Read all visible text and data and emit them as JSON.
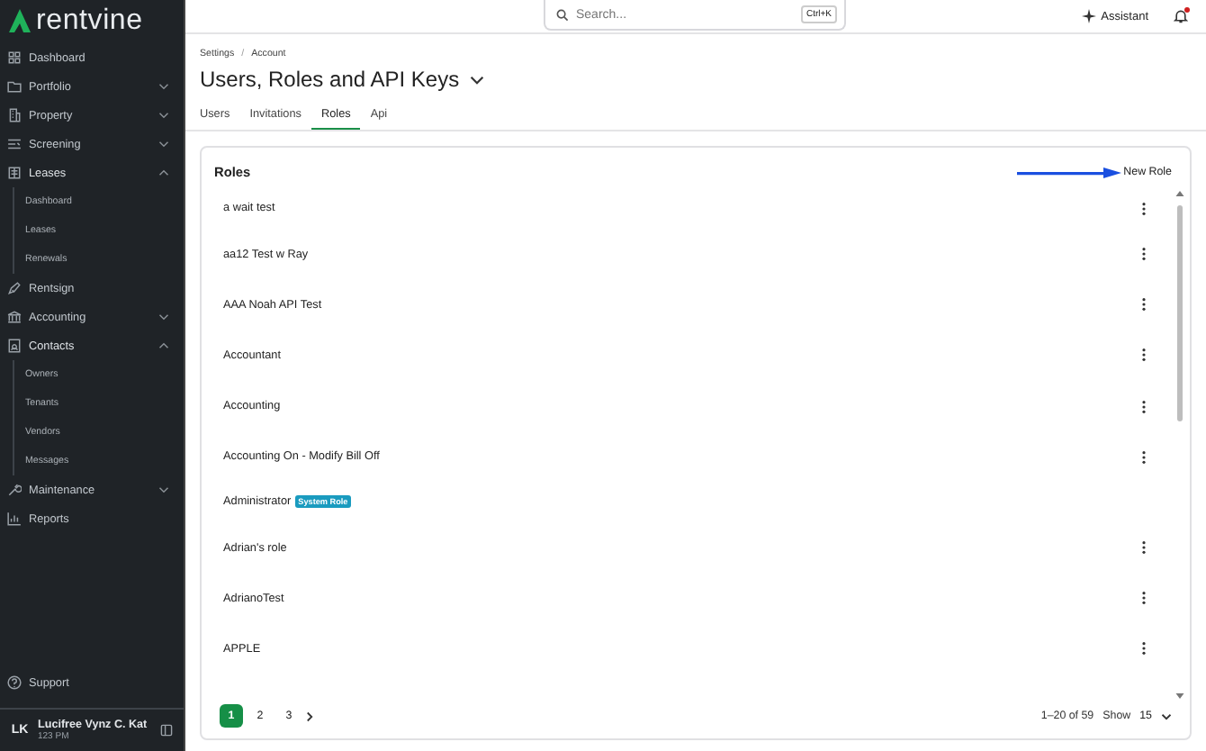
{
  "sidebar": {
    "logo": "rentvine",
    "items": [
      {
        "label": "Dashboard"
      },
      {
        "label": "Portfolio",
        "expanded": false
      },
      {
        "label": "Property",
        "expanded": false
      },
      {
        "label": "Screening",
        "expanded": false
      },
      {
        "label": "Leases",
        "expanded": true,
        "children": [
          {
            "label": "Dashboard"
          },
          {
            "label": "Leases"
          },
          {
            "label": "Renewals"
          }
        ]
      },
      {
        "label": "Rentsign"
      },
      {
        "label": "Accounting",
        "expanded": false
      },
      {
        "label": "Contacts",
        "expanded": true,
        "children": [
          {
            "label": "Owners"
          },
          {
            "label": "Tenants"
          },
          {
            "label": "Vendors"
          },
          {
            "label": "Messages"
          }
        ]
      },
      {
        "label": "Maintenance",
        "expanded": false
      },
      {
        "label": "Reports"
      }
    ],
    "support": "Support",
    "user": {
      "initials": "LK",
      "name": "Lucifree Vynz C. Kat",
      "time": "123 PM"
    }
  },
  "topbar": {
    "search_placeholder": "Search...",
    "shortcut": "Ctrl+K",
    "assistant": "Assistant",
    "has_notification": true
  },
  "breadcrumb": {
    "separator": "/",
    "items": [
      "Settings",
      "Account"
    ]
  },
  "title": "Users, Roles and API Keys",
  "tabs": [
    {
      "label": "Users",
      "selected": false
    },
    {
      "label": "Invitations",
      "selected": false
    },
    {
      "label": "Roles",
      "selected": true
    },
    {
      "label": "Api",
      "selected": false
    }
  ],
  "card": {
    "title": "Roles",
    "action": "New Role",
    "roles": [
      {
        "name": "a wait test",
        "menu": true
      },
      {
        "name": "aa12 Test w Ray",
        "menu": true
      },
      {
        "name": "AAA Noah API Test",
        "menu": true
      },
      {
        "name": "Accountant",
        "menu": true
      },
      {
        "name": "Accounting",
        "menu": true
      },
      {
        "name": "Accounting On - Modify Bill Off",
        "menu": true
      },
      {
        "name": "Administrator",
        "badge": "System Role",
        "menu": false
      },
      {
        "name": "Adrian's role",
        "menu": true
      },
      {
        "name": "AdrianoTest",
        "menu": true
      },
      {
        "name": "APPLE",
        "menu": true
      }
    ]
  },
  "pagination": {
    "pages": [
      {
        "label": "1",
        "selected": true
      },
      {
        "label": "2",
        "selected": false
      },
      {
        "label": "3",
        "selected": false
      }
    ],
    "range": "1–20 of 59",
    "show_label": "Show",
    "page_size": "15"
  }
}
